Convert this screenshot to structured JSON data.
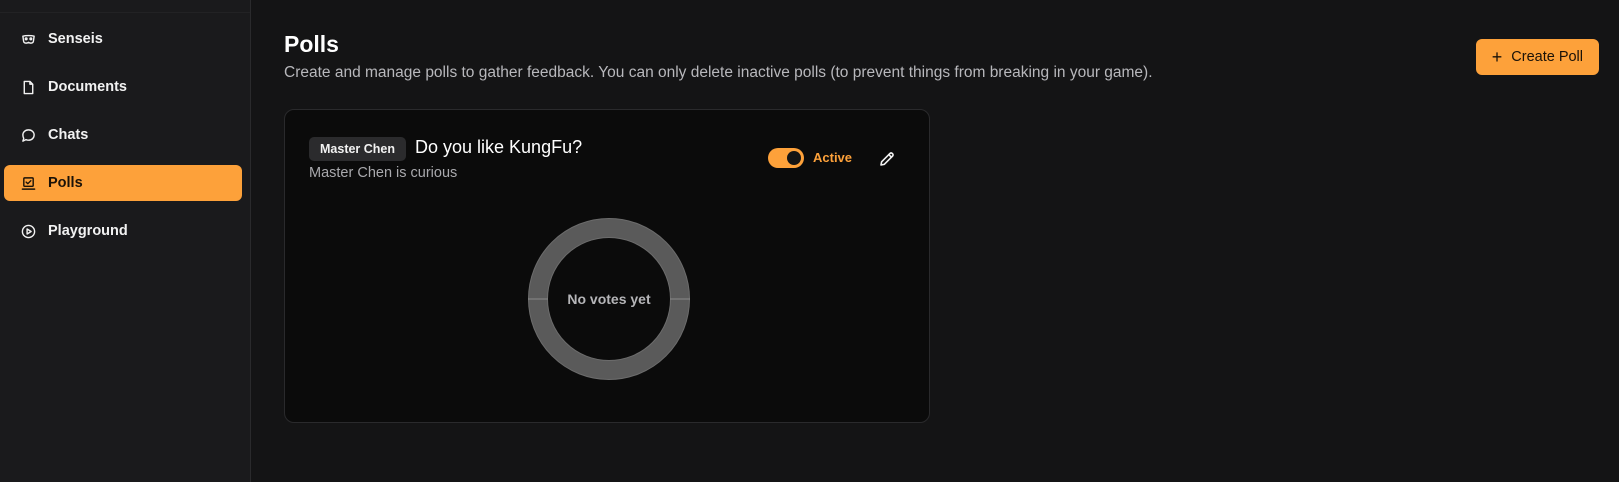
{
  "sidebar": {
    "items": [
      {
        "label": "Senseis",
        "icon": "mask-icon",
        "active": false
      },
      {
        "label": "Documents",
        "icon": "file-icon",
        "active": false
      },
      {
        "label": "Chats",
        "icon": "chat-bubble-icon",
        "active": false
      },
      {
        "label": "Polls",
        "icon": "poll-icon",
        "active": true
      },
      {
        "label": "Playground",
        "icon": "play-circle-icon",
        "active": false
      }
    ]
  },
  "header": {
    "title": "Polls",
    "subtitle": "Create and manage polls to gather feedback. You can only delete inactive polls (to prevent things from breaking in your game).",
    "create_button_label": "Create Poll"
  },
  "poll": {
    "sensei_badge": "Master Chen",
    "title": "Do you like KungFu?",
    "description": "Master Chen is curious",
    "status_label": "Active",
    "active": true,
    "empty_chart_text": "No votes yet"
  },
  "colors": {
    "accent": "#fda13a",
    "background": "#141415",
    "card": "#0b0b0b",
    "donut": "#5a5a5a"
  }
}
